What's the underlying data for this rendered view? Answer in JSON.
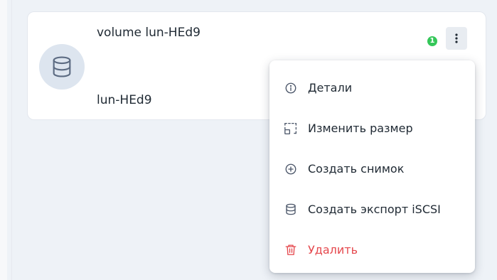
{
  "card": {
    "title": "volume lun-HEd9",
    "subtitle": "lun-HEd9",
    "avatar_icon": "database-icon",
    "badge_count": "1",
    "badge_color": "#34c759",
    "menu_button_icon": "kebab-vertical-icon"
  },
  "menu": {
    "items": [
      {
        "label": "Детали",
        "icon": "info-circle-icon"
      },
      {
        "label": "Изменить размер",
        "icon": "resize-icon"
      },
      {
        "label": "Создать снимок",
        "icon": "plus-circle-icon"
      },
      {
        "label": "Создать экспорт iSCSI",
        "icon": "database-icon"
      },
      {
        "label": "Удалить",
        "icon": "trash-icon",
        "color": "#e5484d"
      }
    ]
  }
}
